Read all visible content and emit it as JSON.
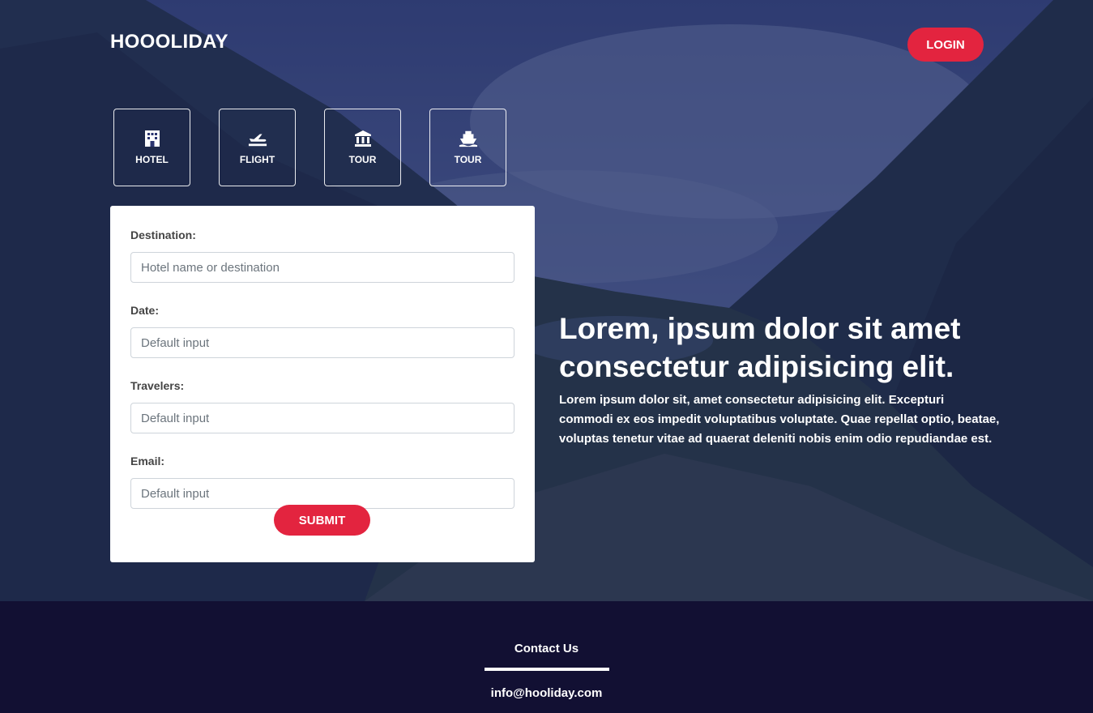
{
  "header": {
    "brand": "HOOOLIDAY",
    "login_label": "LOGIN"
  },
  "tabs": [
    {
      "label": "HOTEL",
      "icon": "hotel-icon"
    },
    {
      "label": "FLIGHT",
      "icon": "plane-icon"
    },
    {
      "label": "TOUR",
      "icon": "landmark-icon"
    },
    {
      "label": "TOUR",
      "icon": "ship-icon"
    }
  ],
  "form": {
    "destination_label": "Destination:",
    "destination_placeholder": "Hotel name or destination",
    "date_label": "Date:",
    "date_placeholder": "Default input",
    "travelers_label": "Travelers:",
    "travelers_placeholder": "Default input",
    "email_label": "Email:",
    "email_placeholder": "Default input",
    "submit_label": "SUBMIT"
  },
  "hero": {
    "title": "Lorem, ipsum dolor sit amet consectetur adipisicing elit.",
    "description": "Lorem ipsum dolor sit, amet consectetur adipisicing elit. Excepturi commodi ex eos impedit voluptatibus voluptate. Quae repellat optio, beatae, voluptas tenetur vitae ad quaerat deleniti nobis enim odio repudiandae est."
  },
  "footer": {
    "contact_title": "Contact Us",
    "email": "info@hooliday.com"
  },
  "colors": {
    "accent": "#e3243f",
    "footer_bg": "#121033",
    "overlay": "#222a64"
  }
}
